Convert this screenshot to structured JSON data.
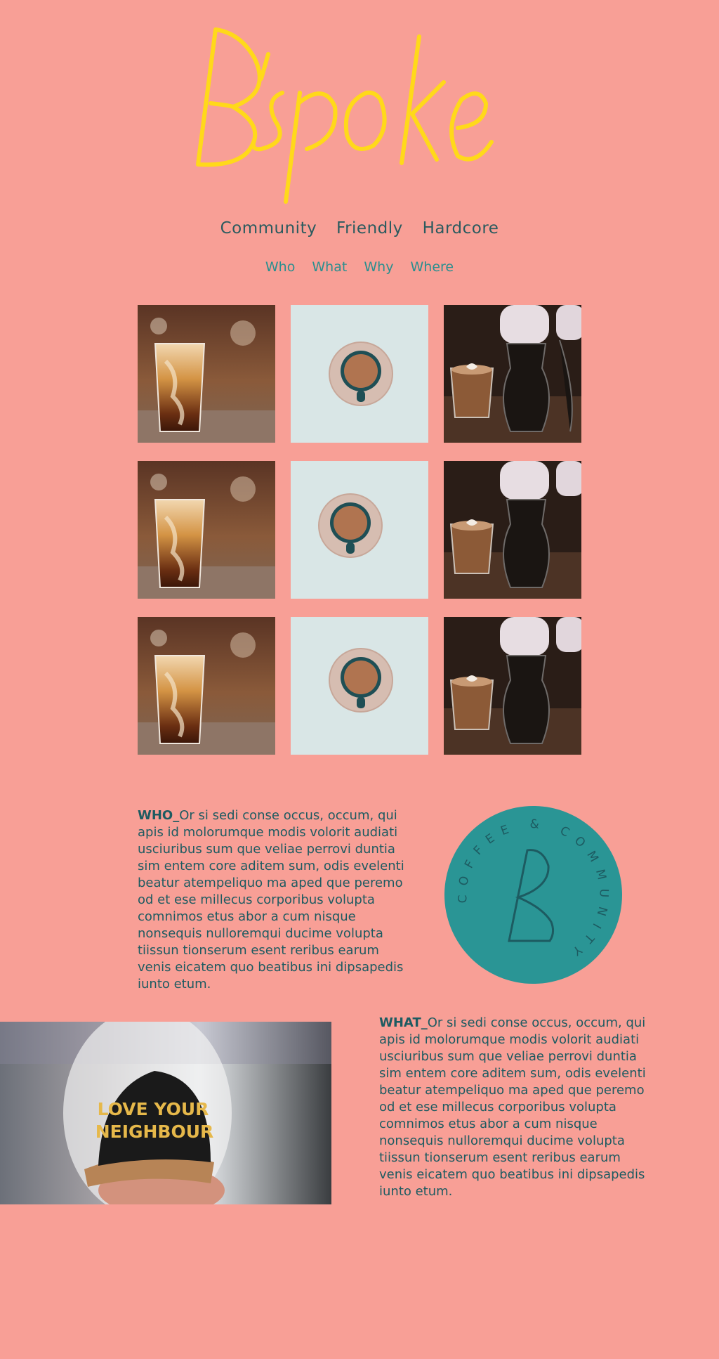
{
  "brand": {
    "logo_text": "B'spoke"
  },
  "tagline": [
    "Community",
    "Friendly",
    "Hardcore"
  ],
  "nav": [
    "Who",
    "What",
    "Why",
    "Where"
  ],
  "gallery": {
    "rows": 3,
    "items": [
      "iced-coffee-photo",
      "espresso-cup-photo",
      "latte-carafes-photo"
    ]
  },
  "who": {
    "heading": "WHO_",
    "body": "Or si sedi conse occus, occum, qui apis id molorumque modis volorit audiati usciuribus sum que veliae perrovi duntia sim entem core aditem sum, odis evelenti beatur atempeliquo ma aped que peremo od et ese millecus corporibus volupta comnimos etus abor a cum nisque nonsequis nulloremqui ducime volupta tiissun tionserum esent reribus earum venis eicatem quo beatibus ini dipsapedis iunto etum."
  },
  "badge": {
    "letter": "B",
    "ring_text": "COFFEE & COMMUNITY"
  },
  "photo": {
    "cap_text_line1": "LOVE YOUR",
    "cap_text_line2": "NEIGHBOUR"
  },
  "what": {
    "heading": "WHAT_",
    "body": "Or si sedi conse occus, occum, qui apis id molorumque modis volorit audiati usciuribus sum que veliae perrovi duntia sim entem core aditem sum, odis evelenti beatur atempeliquo ma aped que peremo od et ese millecus corporibus volupta comnimos etus abor a cum nisque nonsequis nulloremqui ducime volupta tiissun tionserum esent reribus earum venis eicatem quo beatibus ini dipsapedis iunto etum."
  },
  "colors": {
    "background": "#f89f96",
    "logo": "#ffd91a",
    "teal": "#2a9595",
    "text": "#1d5b61"
  }
}
